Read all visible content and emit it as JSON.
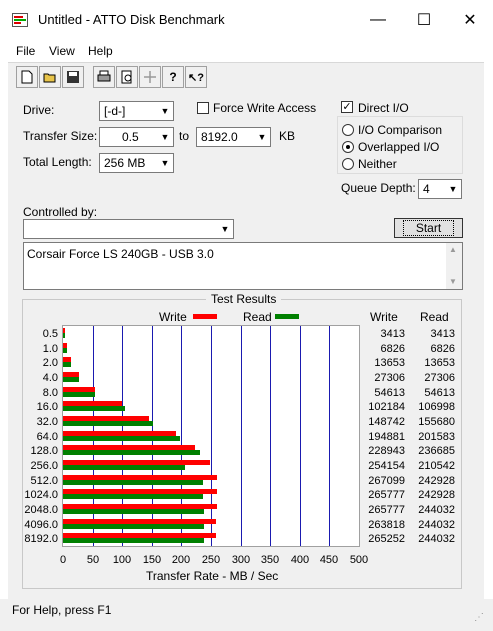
{
  "window": {
    "title": "Untitled - ATTO Disk Benchmark"
  },
  "caption_buttons": {
    "minimize": "—",
    "maximize": "☐",
    "close": "✕"
  },
  "menu": [
    "File",
    "View",
    "Help"
  ],
  "toolbar": {
    "buttons": [
      "new-file",
      "open-folder",
      "save",
      "print",
      "print-preview",
      "move",
      "help",
      "context-help"
    ]
  },
  "settings": {
    "drive_label": "Drive:",
    "drive_value": "[-d-]",
    "force_write_label": "Force Write Access",
    "direct_io_label": "Direct I/O",
    "direct_io_checked": true,
    "transfer_size_label": "Transfer Size:",
    "transfer_from": "0.5",
    "to_label": "to",
    "transfer_to": "8192.0",
    "kb_label": "KB",
    "total_length_label": "Total Length:",
    "total_length_value": "256 MB",
    "io_comparison_label": "I/O Comparison",
    "overlapped_io_label": "Overlapped I/O",
    "neither_label": "Neither",
    "queue_depth_label": "Queue Depth:",
    "queue_depth_value": "4",
    "controlled_by_label": "Controlled by:",
    "controlled_by_value": "",
    "start_label": "Start",
    "description": "Corsair Force LS 240GB - USB 3.0"
  },
  "results": {
    "title": "Test Results",
    "legend_write": "Write",
    "legend_read": "Read",
    "col_write": "Write",
    "col_read": "Read",
    "write_color": "#ff0000",
    "read_color": "#008000",
    "xlabel": "Transfer Rate - MB / Sec"
  },
  "chart_data": {
    "type": "bar",
    "orientation": "horizontal",
    "categories": [
      "0.5",
      "1.0",
      "2.0",
      "4.0",
      "8.0",
      "16.0",
      "32.0",
      "64.0",
      "128.0",
      "256.0",
      "512.0",
      "1024.0",
      "2048.0",
      "4096.0",
      "8192.0"
    ],
    "series": [
      {
        "name": "Write",
        "values": [
          3413,
          6826,
          13653,
          27306,
          54613,
          102184,
          148742,
          194881,
          228943,
          254154,
          267099,
          265777,
          265777,
          263818,
          265252
        ]
      },
      {
        "name": "Read",
        "values": [
          3413,
          6826,
          13653,
          27306,
          54613,
          106998,
          155680,
          201583,
          236685,
          210542,
          242928,
          242928,
          244032,
          244032,
          244032
        ]
      }
    ],
    "xticks": [
      "0",
      "50",
      "100",
      "150",
      "200",
      "250",
      "300",
      "350",
      "400",
      "450",
      "500"
    ],
    "xlim": [
      0,
      500
    ],
    "xlabel": "Transfer Rate - MB / Sec",
    "grid": "vertical"
  },
  "status": {
    "text": "For Help, press F1"
  }
}
